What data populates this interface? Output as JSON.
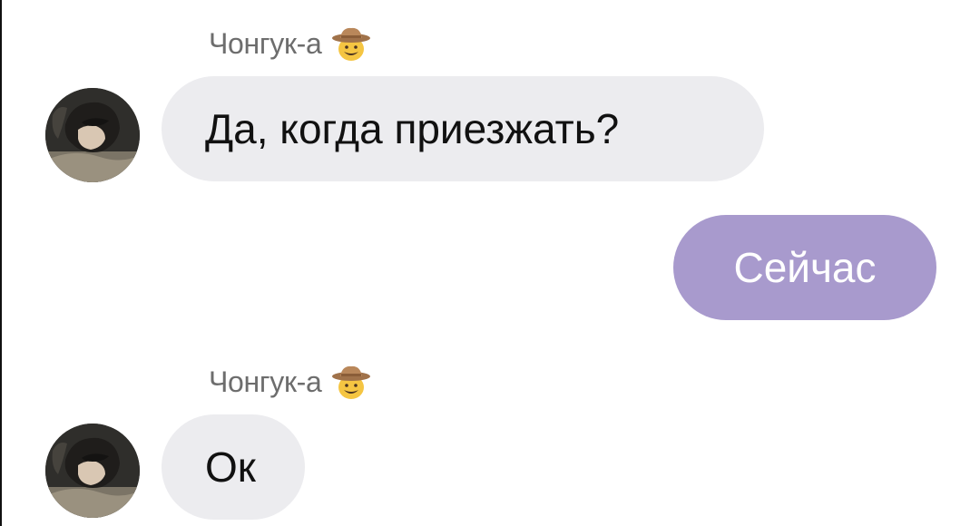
{
  "chat": {
    "messages": [
      {
        "direction": "incoming",
        "sender": "Чонгук-а",
        "sender_emoji": "cowboy-hat-face-icon",
        "text": "Да, когда приезжать?"
      },
      {
        "direction": "outgoing",
        "text": "Сейчас"
      },
      {
        "direction": "incoming",
        "sender": "Чонгук-а",
        "sender_emoji": "cowboy-hat-face-icon",
        "text": "Ок"
      }
    ]
  },
  "colors": {
    "incoming_bubble": "#ececef",
    "outgoing_bubble": "#a89acd",
    "sender_name": "#6d6d6d",
    "incoming_text": "#111111",
    "outgoing_text": "#ffffff"
  }
}
